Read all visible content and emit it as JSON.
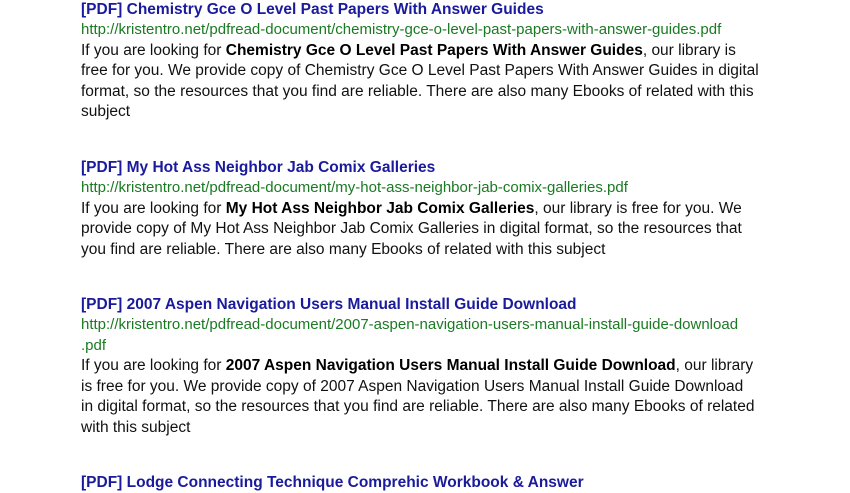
{
  "entries": [
    {
      "title": "[PDF] Chemistry Gce O Level Past Papers With Answer Guides",
      "url_lines": [
        "http://kristentro.net/pdfread-document/chemistry-gce-o-level-past-papers-with-answer-guides.pdf"
      ],
      "desc_prefix": "If you are looking for ",
      "desc_bold": "Chemistry Gce O Level Past Papers With Answer Guides",
      "desc_lines": [
        ", our library is",
        "free for you. We provide copy of Chemistry Gce O Level Past Papers With Answer Guides in digital",
        "format, so the resources that you find are reliable. There are also many Ebooks of related with this",
        "subject"
      ]
    },
    {
      "title": "[PDF] My Hot Ass Neighbor Jab Comix Galleries",
      "url_lines": [
        "http://kristentro.net/pdfread-document/my-hot-ass-neighbor-jab-comix-galleries.pdf"
      ],
      "desc_prefix": "If you are looking for ",
      "desc_bold": "My Hot Ass Neighbor Jab Comix Galleries",
      "desc_lines": [
        ", our library is free for you. We",
        "provide copy of My Hot Ass Neighbor Jab Comix Galleries in digital format, so the resources that",
        "you find are reliable. There are also many Ebooks of related with this subject"
      ]
    },
    {
      "title": "[PDF] 2007 Aspen Navigation Users Manual Install Guide Download",
      "url_lines": [
        "http://kristentro.net/pdfread-document/2007-aspen-navigation-users-manual-install-guide-download",
        ".pdf"
      ],
      "desc_prefix": "If you are looking for ",
      "desc_bold": "2007 Aspen Navigation Users Manual Install Guide Download",
      "desc_lines": [
        ", our library",
        "is free for you. We provide copy of 2007 Aspen Navigation Users Manual Install Guide Download",
        "in digital format, so the resources that you find are reliable. There are also many Ebooks of related",
        "with this subject"
      ]
    },
    {
      "title": "[PDF] Lodge Connecting Technique Comprehic Workbook & Answer",
      "url_lines": [],
      "desc_prefix": "",
      "desc_bold": "",
      "desc_lines": []
    }
  ]
}
